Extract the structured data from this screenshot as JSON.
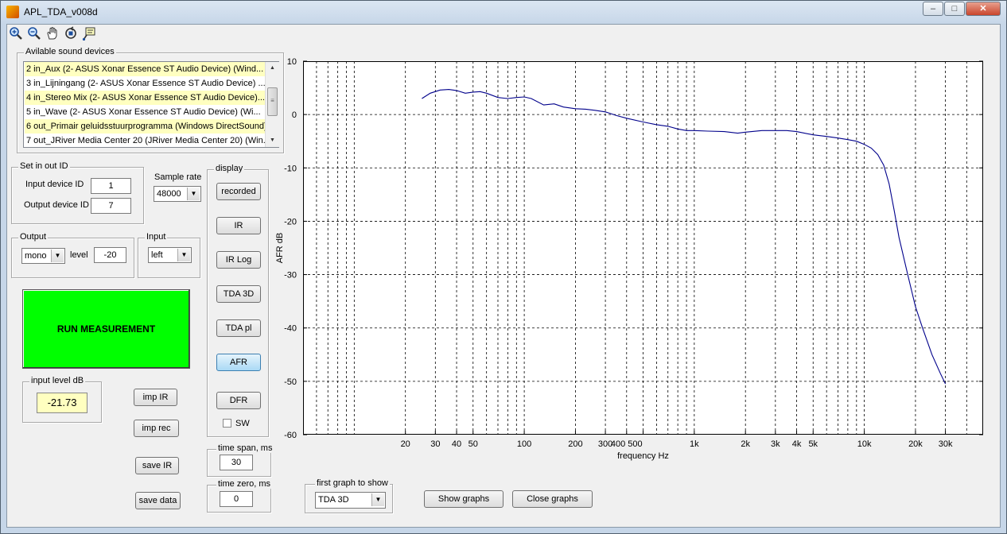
{
  "window": {
    "title": "APL_TDA_v008d",
    "controls": {
      "minimize": "–",
      "maximize": "□",
      "close": "✕"
    }
  },
  "toolbar": {
    "icons": [
      "zoom-in-icon",
      "zoom-out-icon",
      "pan-hand-icon",
      "rotate-3d-icon",
      "data-cursor-icon"
    ]
  },
  "devices": {
    "legend": "Avilable sound devices",
    "items": [
      {
        "label": "2 in_Aux (2- ASUS Xonar Essence ST Audio Device) (Wind...",
        "highlight": true
      },
      {
        "label": "3 in_Lijningang (2- ASUS Xonar Essence ST Audio Device) ...",
        "highlight": false
      },
      {
        "label": "4 in_Stereo Mix (2- ASUS Xonar Essence ST Audio Device)...",
        "highlight": true
      },
      {
        "label": "5 in_Wave (2- ASUS Xonar Essence ST Audio Device) (Wi...",
        "highlight": false
      },
      {
        "label": "6 out_Primair geluidsstuurprogramma (Windows DirectSound)",
        "highlight": true
      },
      {
        "label": "7 out_JRiver Media Center 20 (JRiver Media Center 20) (Win...",
        "highlight": false
      }
    ]
  },
  "io": {
    "legend": "Set in out ID",
    "input_label": "Input device ID",
    "input_value": "1",
    "output_label": "Output device ID",
    "output_value": "7"
  },
  "sample_rate": {
    "label": "Sample rate",
    "value": "48000"
  },
  "output": {
    "legend": "Output",
    "mode": "mono",
    "level_label": "level",
    "level_value": "-20"
  },
  "input": {
    "legend": "Input",
    "channel": "left"
  },
  "run": {
    "label": "RUN MEASUREMENT"
  },
  "input_level": {
    "legend": "input level dB",
    "value": "-21.73"
  },
  "display": {
    "legend": "display",
    "buttons": [
      "recorded",
      "IR",
      "IR Log",
      "TDA 3D",
      "TDA pl",
      "AFR",
      "DFR"
    ],
    "active": "AFR",
    "sw_label": "SW",
    "sw_checked": false
  },
  "actions": {
    "imp_ir": "imp IR",
    "imp_rec": "imp rec",
    "save_ir": "save IR",
    "save_data": "save data"
  },
  "time_span": {
    "legend": "time span, ms",
    "value": "30"
  },
  "time_zero": {
    "legend": "time zero, ms",
    "value": "0"
  },
  "first_graph": {
    "legend": "first graph to show",
    "value": "TDA 3D"
  },
  "graph_buttons": {
    "show": "Show graphs",
    "close": "Close graphs"
  },
  "chart_data": {
    "type": "line",
    "xlabel": "frequency  Hz",
    "ylabel": "AFR dB",
    "xscale": "log",
    "xlim": [
      5,
      50000
    ],
    "ylim": [
      -60,
      10
    ],
    "grid": true,
    "xticks": [
      20,
      30,
      40,
      50,
      100,
      200,
      300,
      400,
      500,
      1000,
      2000,
      3000,
      4000,
      5000,
      10000,
      20000,
      30000
    ],
    "xtick_labels": [
      "20",
      "30",
      "40",
      "50",
      "100",
      "200",
      "300",
      "400 500",
      "",
      "1k",
      "2k",
      "3k",
      "4k",
      "5k",
      "10k",
      "20k",
      "30k"
    ],
    "yticks": [
      10,
      0,
      -10,
      -20,
      -30,
      -40,
      -50,
      -60
    ],
    "line_color": "#00008b",
    "x": [
      25,
      28,
      32,
      36,
      40,
      45,
      50,
      55,
      60,
      70,
      80,
      90,
      100,
      110,
      130,
      150,
      170,
      200,
      230,
      260,
      300,
      350,
      400,
      500,
      600,
      700,
      800,
      900,
      1000,
      1200,
      1500,
      1800,
      2000,
      2500,
      3000,
      3500,
      4000,
      5000,
      6000,
      7000,
      8000,
      9000,
      10000,
      11000,
      12000,
      13000,
      14000,
      15000,
      16000,
      18000,
      20000,
      22000,
      25000,
      28000,
      30000
    ],
    "y": [
      3.0,
      4.0,
      4.6,
      4.7,
      4.5,
      4.0,
      4.2,
      4.3,
      4.0,
      3.2,
      3.0,
      3.2,
      3.3,
      3.0,
      1.8,
      2.0,
      1.4,
      1.1,
      1.0,
      0.8,
      0.5,
      -0.2,
      -0.7,
      -1.4,
      -1.9,
      -2.2,
      -2.7,
      -3.0,
      -3.0,
      -3.1,
      -3.2,
      -3.5,
      -3.3,
      -3.0,
      -3.0,
      -3.0,
      -3.2,
      -3.8,
      -4.1,
      -4.4,
      -4.7,
      -5.0,
      -5.6,
      -6.3,
      -7.5,
      -9.5,
      -13,
      -18,
      -23,
      -30,
      -36,
      -40,
      -45,
      -48.5,
      -50.5
    ]
  }
}
